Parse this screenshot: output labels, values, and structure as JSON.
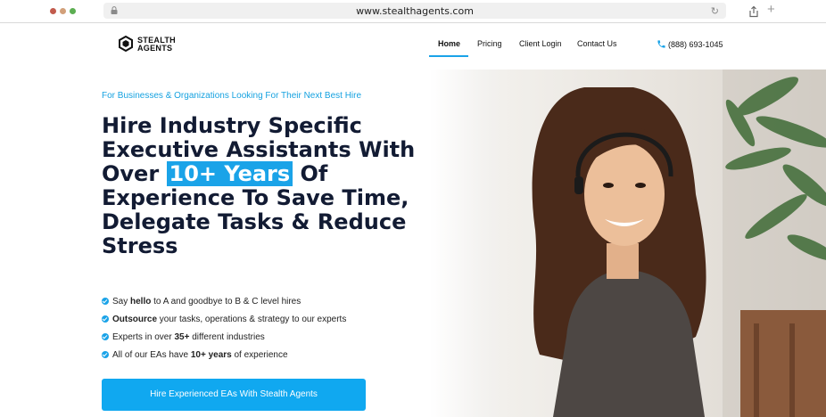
{
  "browser": {
    "url": "www.stealthagents.com"
  },
  "brand": {
    "name_line1": "STEALTH",
    "name_line2": "AGENTS",
    "accent": "#1aa3e8",
    "dark": "#121b33"
  },
  "nav": {
    "items": [
      {
        "label": "Home",
        "active": true
      },
      {
        "label": "Pricing"
      },
      {
        "label": "Client Login"
      },
      {
        "label": "Contact Us"
      }
    ],
    "phone": "(888) 693-1045"
  },
  "hero": {
    "kicker": "For Businesses & Organizations Looking For Their Next Best Hire",
    "headline": {
      "before": "Hire Industry Specific Executive Assistants With Over",
      "highlight": "10+ Years",
      "after": "Of Experience To Save Time, Delegate Tasks & Reduce Stress"
    },
    "bullets": [
      {
        "pre": "Say ",
        "bold": "hello",
        "post": " to A and goodbye to B & C level hires"
      },
      {
        "pre": "",
        "bold": "Outsource",
        "post": " your tasks, operations & strategy to our experts"
      },
      {
        "pre": "Experts in over ",
        "bold": "35+",
        "post": " different industries"
      },
      {
        "pre": "All of our EAs have ",
        "bold": "10+ years",
        "post": " of experience"
      }
    ],
    "cta_label": "Hire Experienced EAs With Stealth Agents"
  }
}
